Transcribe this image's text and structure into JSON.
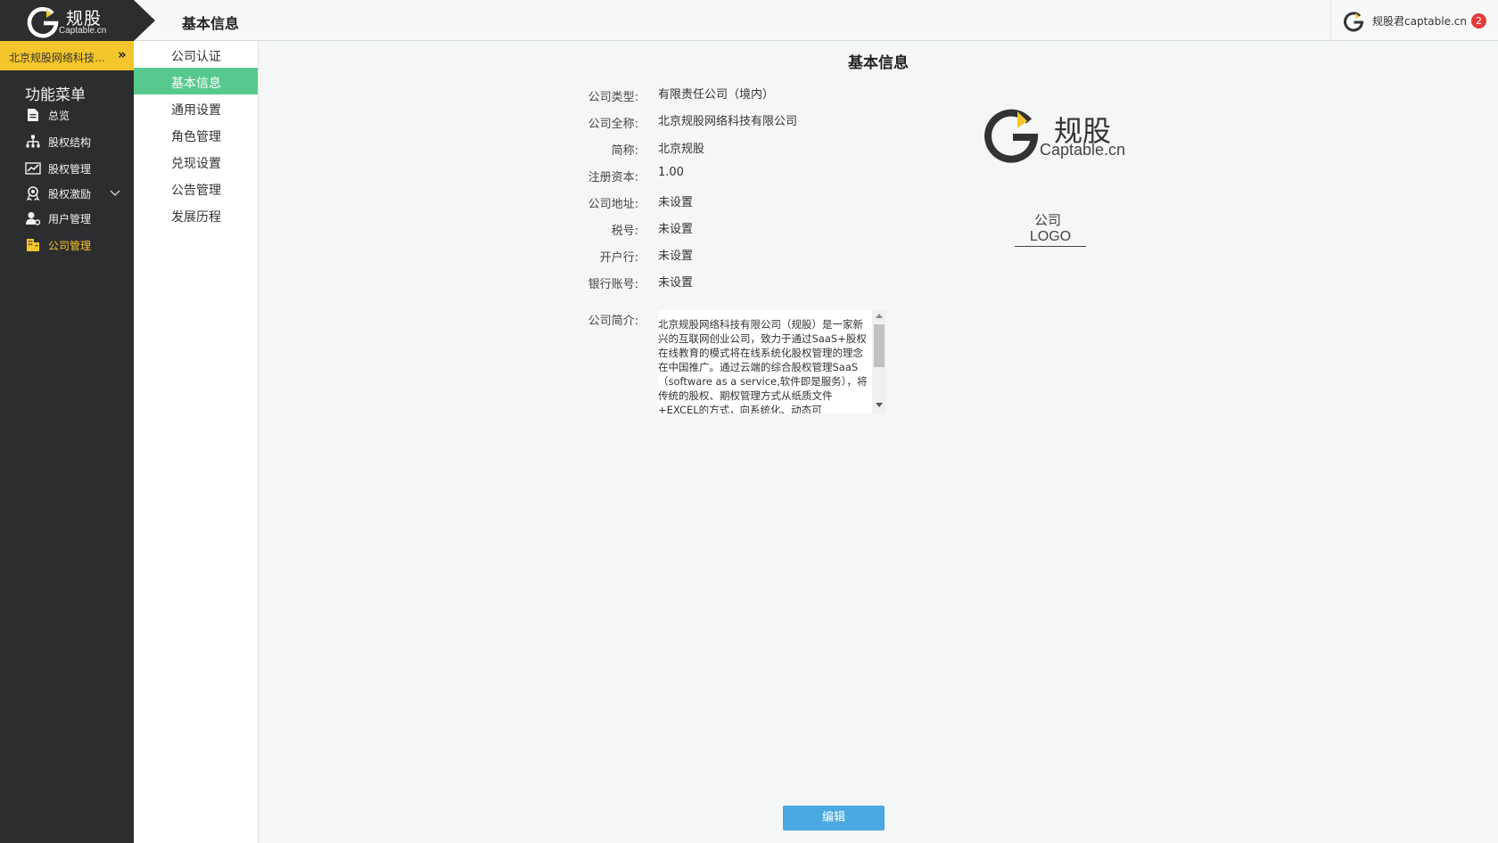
{
  "brand": {
    "name": "规股",
    "sub": "Captable.cn"
  },
  "topbar": {
    "title": "基本信息",
    "user": "规股君captable.cn",
    "badge_count": "2"
  },
  "sidebar": {
    "company": "北京规股网络科技有限公司",
    "more": "»",
    "menu_title": "功能菜单",
    "items": [
      {
        "label": "总览",
        "icon": "document-icon"
      },
      {
        "label": "股权结构",
        "icon": "org-chart-icon"
      },
      {
        "label": "股权管理",
        "icon": "chart-line-icon"
      },
      {
        "label": "股权激励",
        "icon": "award-icon"
      },
      {
        "label": "用户管理",
        "icon": "user-gear-icon"
      },
      {
        "label": "公司管理",
        "icon": "building-icon",
        "active": true
      }
    ]
  },
  "subnav": {
    "items": [
      {
        "label": "公司认证"
      },
      {
        "label": "基本信息",
        "active": true
      },
      {
        "label": "通用设置"
      },
      {
        "label": "角色管理"
      },
      {
        "label": "兑现设置"
      },
      {
        "label": "公告管理"
      },
      {
        "label": "发展历程"
      }
    ]
  },
  "main": {
    "title": "基本信息",
    "fields": [
      {
        "label": "公司类型:",
        "value": "有限责任公司（境内）"
      },
      {
        "label": "公司全称:",
        "value": "北京规股网络科技有限公司"
      },
      {
        "label": "简称:",
        "value": "北京规股"
      },
      {
        "label": "注册资本:",
        "value": "1.00"
      },
      {
        "label": "公司地址:",
        "value": "未设置"
      },
      {
        "label": "税号:",
        "value": "未设置"
      },
      {
        "label": "开户行:",
        "value": "未设置"
      },
      {
        "label": "银行账号:",
        "value": "未设置"
      }
    ],
    "intro_label": "公司简介:",
    "intro_text": "北京规股网络科技有限公司（规股）是一家新兴的互联网创业公司，致力于通过SaaS+股权在线教育的模式将在线系统化股权管理的理念在中国推广。通过云端的综合股权管理SaaS（software as a service,软件即是服务），将传统的股权、期权管理方式从纸质文件+EXCEL的方式，向系统化、动态可",
    "logo": {
      "name": "规股",
      "sub": "Captable.cn",
      "caption1": "公司",
      "caption2": "LOGO"
    },
    "edit_button": "编辑"
  },
  "colors": {
    "sidebar": "#2c2d2f",
    "accent_yellow": "#f4c62b",
    "active_green": "#58c98e",
    "button_blue": "#4aa9e0"
  }
}
